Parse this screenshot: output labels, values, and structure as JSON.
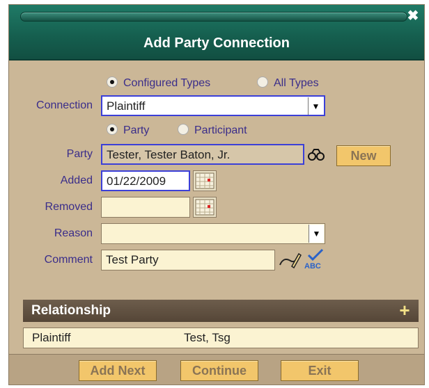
{
  "dialog": {
    "title": "Add Party Connection"
  },
  "type_radios": {
    "configured": "Configured Types",
    "all": "All Types",
    "selected": "configured"
  },
  "connection": {
    "label": "Connection",
    "value": "Plaintiff"
  },
  "party_radios": {
    "party": "Party",
    "participant": "Participant",
    "selected": "party"
  },
  "party": {
    "label": "Party",
    "value": "Tester, Tester Baton, Jr.",
    "new_button": "New"
  },
  "added": {
    "label": "Added",
    "value": "01/22/2009"
  },
  "removed": {
    "label": "Removed",
    "value": ""
  },
  "reason": {
    "label": "Reason",
    "value": ""
  },
  "comment": {
    "label": "Comment",
    "value": "Test Party"
  },
  "relationship": {
    "header": "Relationship",
    "rows": [
      {
        "type": "Plaintiff",
        "name": "Test, Tsg"
      }
    ]
  },
  "footer": {
    "add_next": "Add Next",
    "continue": "Continue",
    "exit": "Exit"
  },
  "icons": {
    "close": "close-icon",
    "search": "binoculars-icon",
    "calendar": "calendar-icon",
    "edit": "pen-icon",
    "spellcheck": "spellcheck-abc-icon",
    "add": "plus-icon"
  },
  "colors": {
    "title_bar": "#155e4e",
    "panel": "#cbb797",
    "label_text": "#3a2d8a",
    "field_bg": "#fbf3d2",
    "button": "#f2c66b",
    "section_header": "#5c4c3d"
  }
}
